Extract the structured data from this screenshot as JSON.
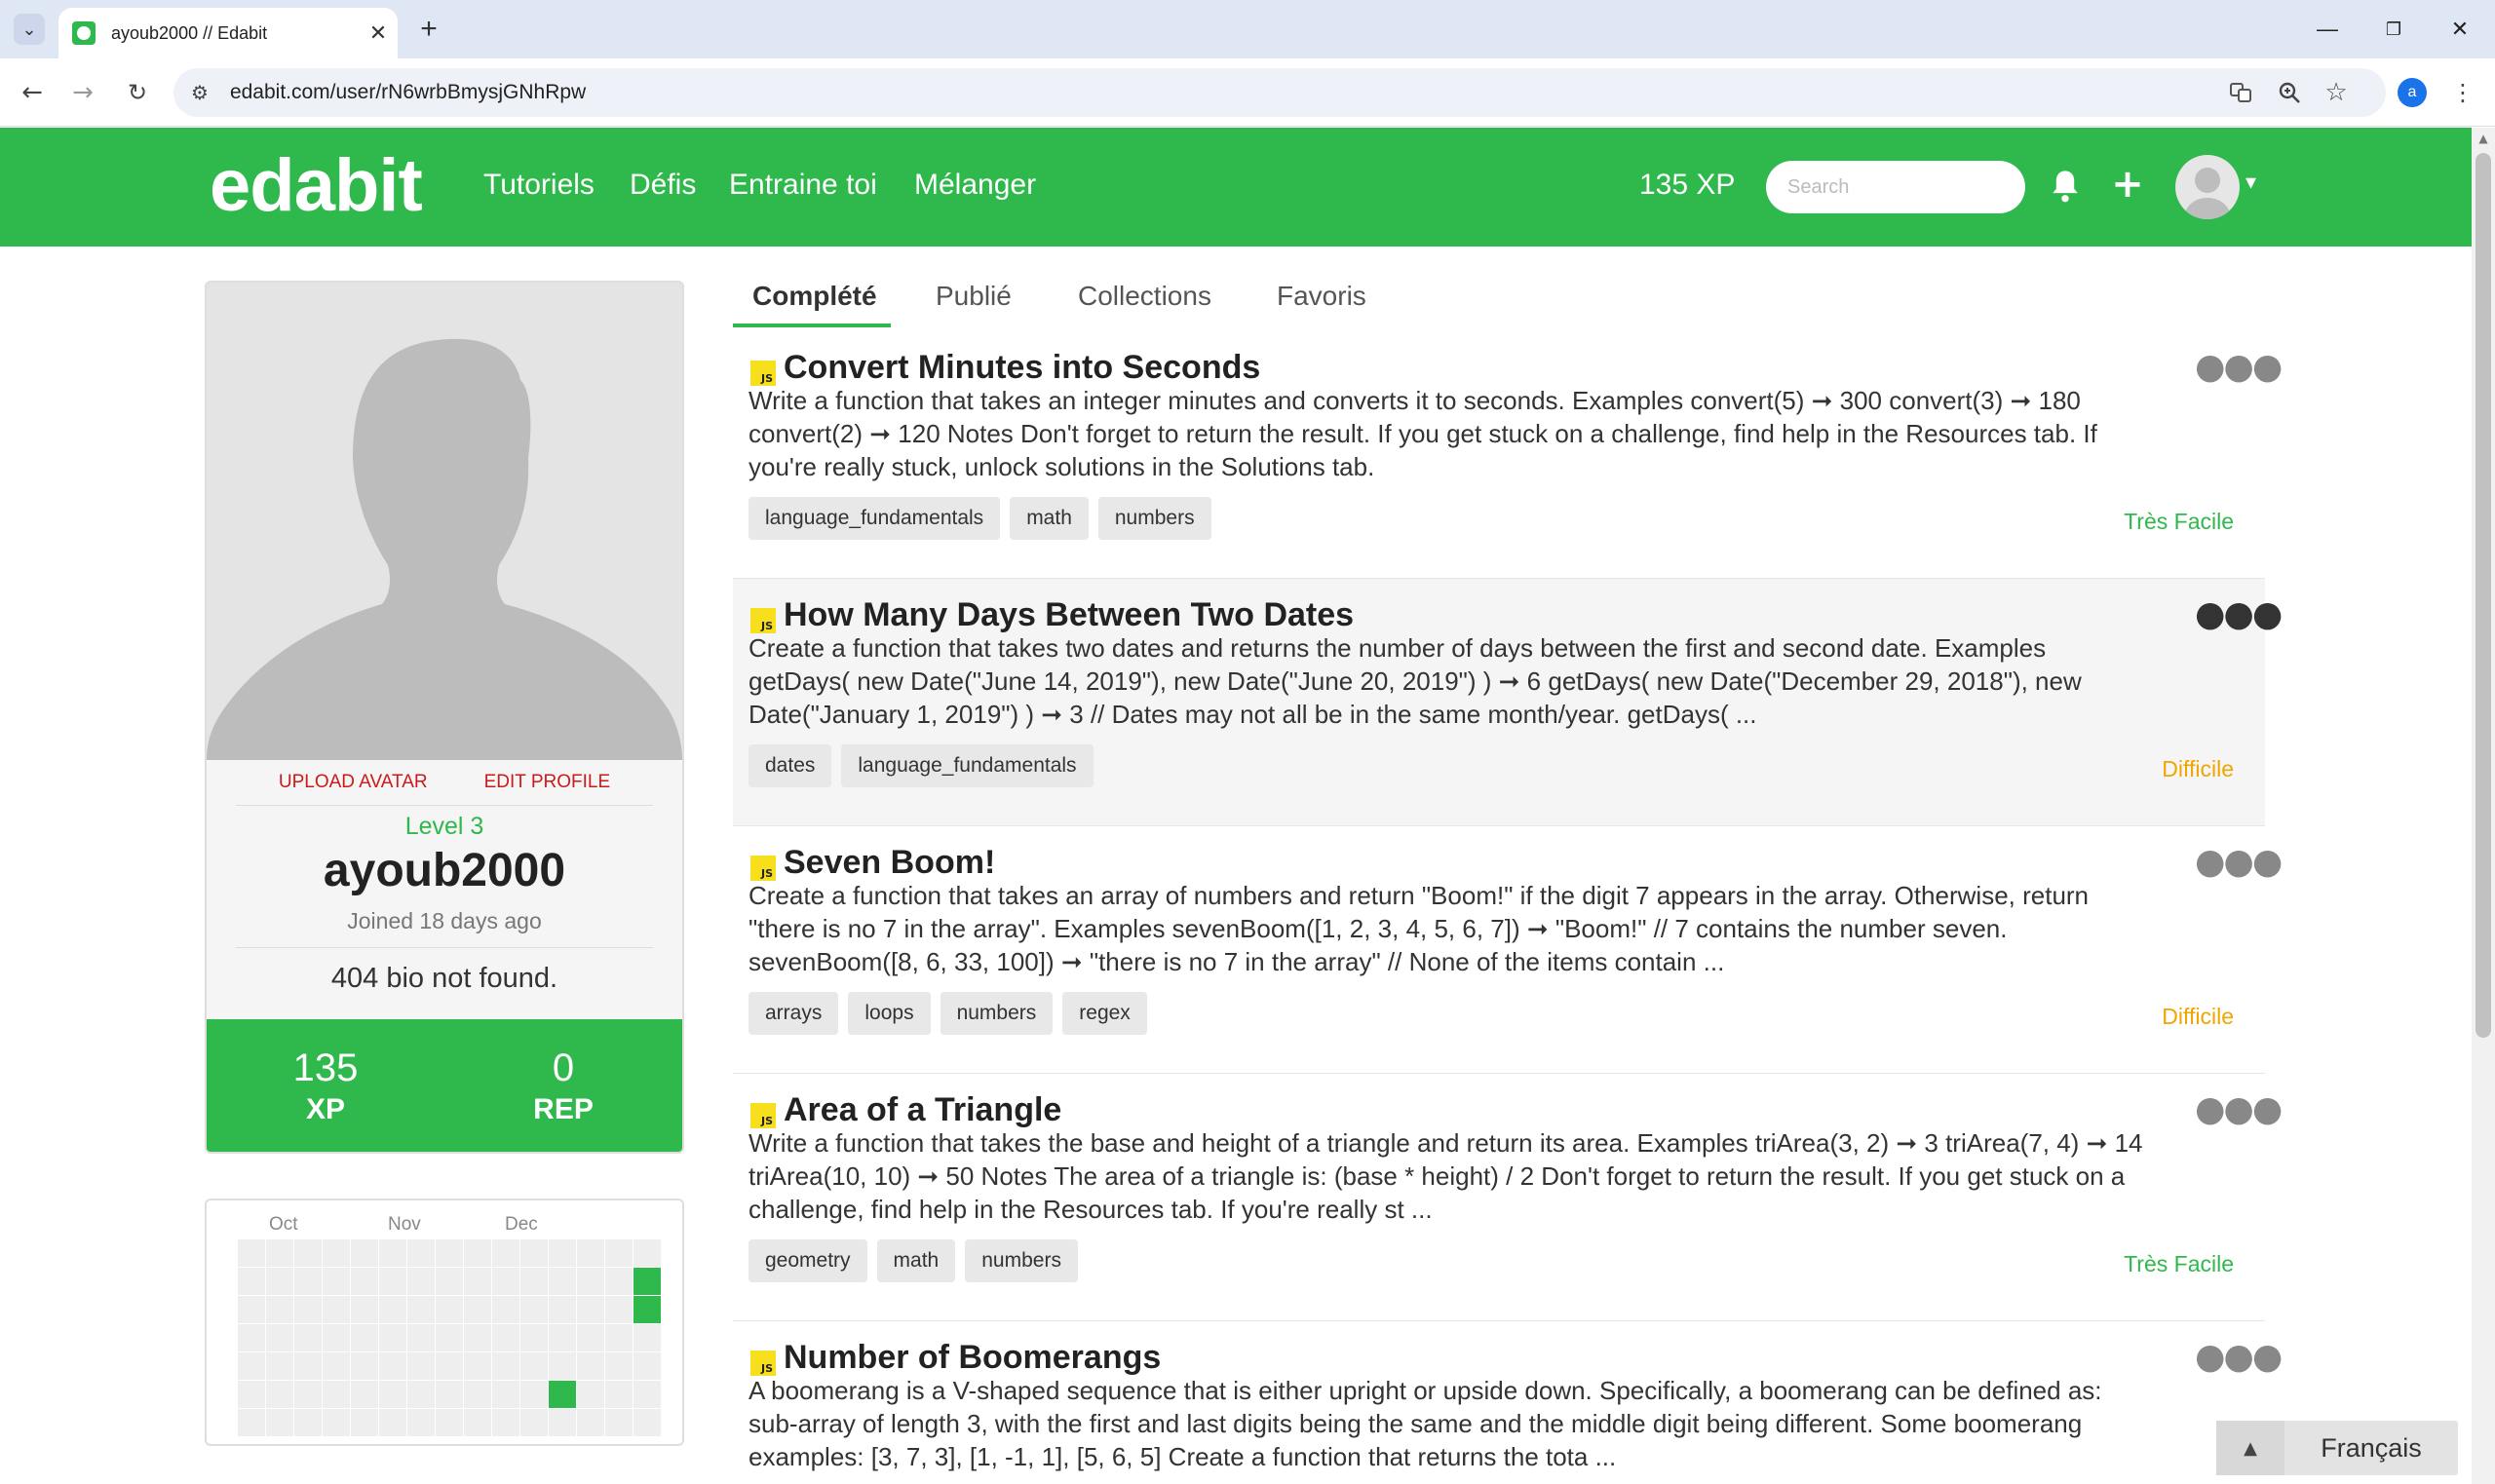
{
  "browser": {
    "tab_title": "ayoub2000 // Edabit",
    "url": "edabit.com/user/rN6wrbBmysjGNhRpw",
    "profile_initial": "a"
  },
  "header": {
    "logo": "edabit",
    "nav": [
      "Tutoriels",
      "Défis",
      "Entraine toi",
      "Mélanger"
    ],
    "xp": "135 XP",
    "search_placeholder": "Search",
    "brand_color": "#2fb84b"
  },
  "profile": {
    "upload_avatar": "UPLOAD AVATAR",
    "edit_profile": "EDIT PROFILE",
    "level": "Level 3",
    "username": "ayoub2000",
    "joined": "Joined 18 days ago",
    "bio": "404 bio not found.",
    "stats": [
      {
        "value": "135",
        "label": "XP"
      },
      {
        "value": "0",
        "label": "REP"
      }
    ]
  },
  "activity": {
    "months": [
      "Oct",
      "Nov",
      "Dec"
    ],
    "active_cells": [
      {
        "col": 14,
        "row": 1
      },
      {
        "col": 14,
        "row": 2
      },
      {
        "col": 11,
        "row": 5
      }
    ]
  },
  "tabs": [
    "Complété",
    "Publié",
    "Collections",
    "Favoris"
  ],
  "challenges": [
    {
      "lang": "JS",
      "title": "Convert Minutes into Seconds",
      "description": "Write a function that takes an integer minutes and converts it to seconds. Examples convert(5) ➞ 300 convert(3) ➞ 180 convert(2) ➞ 120 Notes Don't forget to return the result. If you get stuck on a challenge, find help in the Resources tab. If you're really stuck, unlock solutions in the Solutions tab.",
      "tags": [
        "language_fundamentals",
        "math",
        "numbers"
      ],
      "difficulty": "Très Facile",
      "difficulty_color": "#2fb84b"
    },
    {
      "lang": "JS",
      "title": "How Many Days Between Two Dates",
      "description": "Create a function that takes two dates and returns the number of days between the first and second date. Examples getDays( new Date(\"June 14, 2019\"), new Date(\"June 20, 2019\") ) ➞ 6 getDays( new Date(\"December 29, 2018\"), new Date(\"January 1, 2019\") ) ➞ 3 // Dates may not all be in the same month/year. getDays( ...",
      "tags": [
        "dates",
        "language_fundamentals"
      ],
      "difficulty": "Difficile",
      "difficulty_color": "#f0a500"
    },
    {
      "lang": "JS",
      "title": "Seven Boom!",
      "description": "Create a function that takes an array of numbers and return \"Boom!\" if the digit 7 appears in the array. Otherwise, return \"there is no 7 in the array\". Examples sevenBoom([1, 2, 3, 4, 5, 6, 7]) ➞ \"Boom!\" // 7 contains the number seven. sevenBoom([8, 6, 33, 100]) ➞ \"there is no 7 in the array\" // None of the items contain ...",
      "tags": [
        "arrays",
        "loops",
        "numbers",
        "regex"
      ],
      "difficulty": "Difficile",
      "difficulty_color": "#f0a500"
    },
    {
      "lang": "JS",
      "title": "Area of a Triangle",
      "description": "Write a function that takes the base and height of a triangle and return its area. Examples triArea(3, 2) ➞ 3 triArea(7, 4) ➞ 14 triArea(10, 10) ➞ 50 Notes The area of a triangle is: (base * height) / 2 Don't forget to return the result. If you get stuck on a challenge, find help in the Resources tab. If you're really st ...",
      "tags": [
        "geometry",
        "math",
        "numbers"
      ],
      "difficulty": "Très Facile",
      "difficulty_color": "#2fb84b"
    },
    {
      "lang": "JS",
      "title": "Number of Boomerangs",
      "description": "A boomerang is a V-shaped sequence that is either upright or upside down. Specifically, a boomerang can be defined as: sub-array of length 3, with the first and last digits being the same and the middle digit being different. Some boomerang examples: [3, 7, 3], [1, -1, 1], [5, 6, 5] Create a function that returns the tota ...",
      "tags": [],
      "difficulty": "",
      "difficulty_color": "#2fb84b"
    }
  ],
  "language_selector": "Français"
}
